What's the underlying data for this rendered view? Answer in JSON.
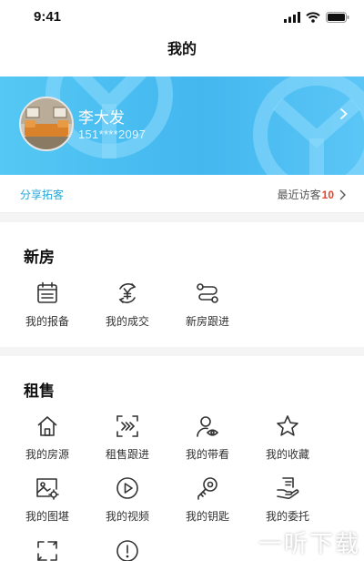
{
  "status_bar": {
    "time": "9:41"
  },
  "header": {
    "title": "我的"
  },
  "profile": {
    "name": "李大发",
    "phone": "151****2097"
  },
  "share": {
    "label": "分享拓客",
    "visitors_label": "最近访客",
    "visitors_count": "10"
  },
  "new_house": {
    "title": "新房",
    "items": [
      {
        "label": "我的报备",
        "icon": "calendar-icon"
      },
      {
        "label": "我的成交",
        "icon": "yuan-cycle-icon"
      },
      {
        "label": "新房跟进",
        "icon": "route-icon"
      }
    ]
  },
  "rent_sale": {
    "title": "租售",
    "items": [
      {
        "label": "我的房源",
        "icon": "house-icon"
      },
      {
        "label": "租售跟进",
        "icon": "scan-forward-icon"
      },
      {
        "label": "我的带看",
        "icon": "user-eye-icon"
      },
      {
        "label": "我的收藏",
        "icon": "star-icon"
      },
      {
        "label": "我的图堪",
        "icon": "image-gear-icon"
      },
      {
        "label": "我的视频",
        "icon": "play-circle-icon"
      },
      {
        "label": "我的钥匙",
        "icon": "key-icon"
      },
      {
        "label": "我的委托",
        "icon": "hand-document-icon"
      }
    ]
  },
  "watermark": {
    "text": "一听下载"
  },
  "colors": {
    "banner": "#43b7ef",
    "accent": "#27a8d8",
    "count": "#e8412c"
  }
}
